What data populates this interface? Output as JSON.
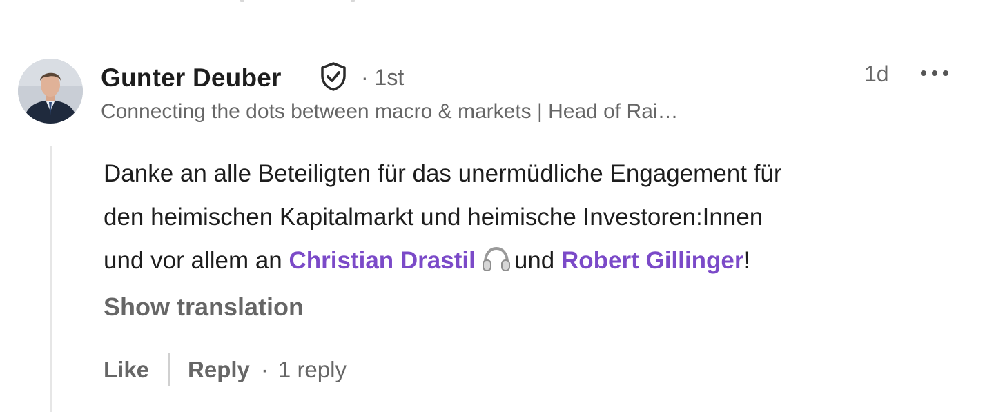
{
  "comment": {
    "author": {
      "name": "Gunter Deuber",
      "verified": true,
      "connection_separator": "·",
      "connection_degree": "1st",
      "headline": "Connecting the dots between macro & markets | Head of Rai…"
    },
    "time_ago": "1d",
    "body": {
      "line_1": "Danke an alle Beteiligten für das unermüdliche Engagement für",
      "line_2": "den heimischen Kapitalmarkt und heimische Investoren:Innen",
      "line_3_start": "und vor allem an ",
      "mention_1": "Christian Drastil",
      "line_3_mid": "und ",
      "mention_2": "Robert Gillinger",
      "line_3_end": "!"
    },
    "show_translation_label": "Show translation",
    "actions": {
      "like_label": "Like",
      "reply_label": "Reply",
      "separator": "·",
      "reply_count": "1 reply"
    }
  },
  "icons": {
    "verified": "shield-check-icon",
    "more": "more-horizontal-icon",
    "emoji": "headphones-icon"
  },
  "colors": {
    "mention": "#7b4ac8",
    "text_primary": "#1d1d1d",
    "text_secondary": "#666666",
    "thread_line": "#e6e6e6"
  }
}
